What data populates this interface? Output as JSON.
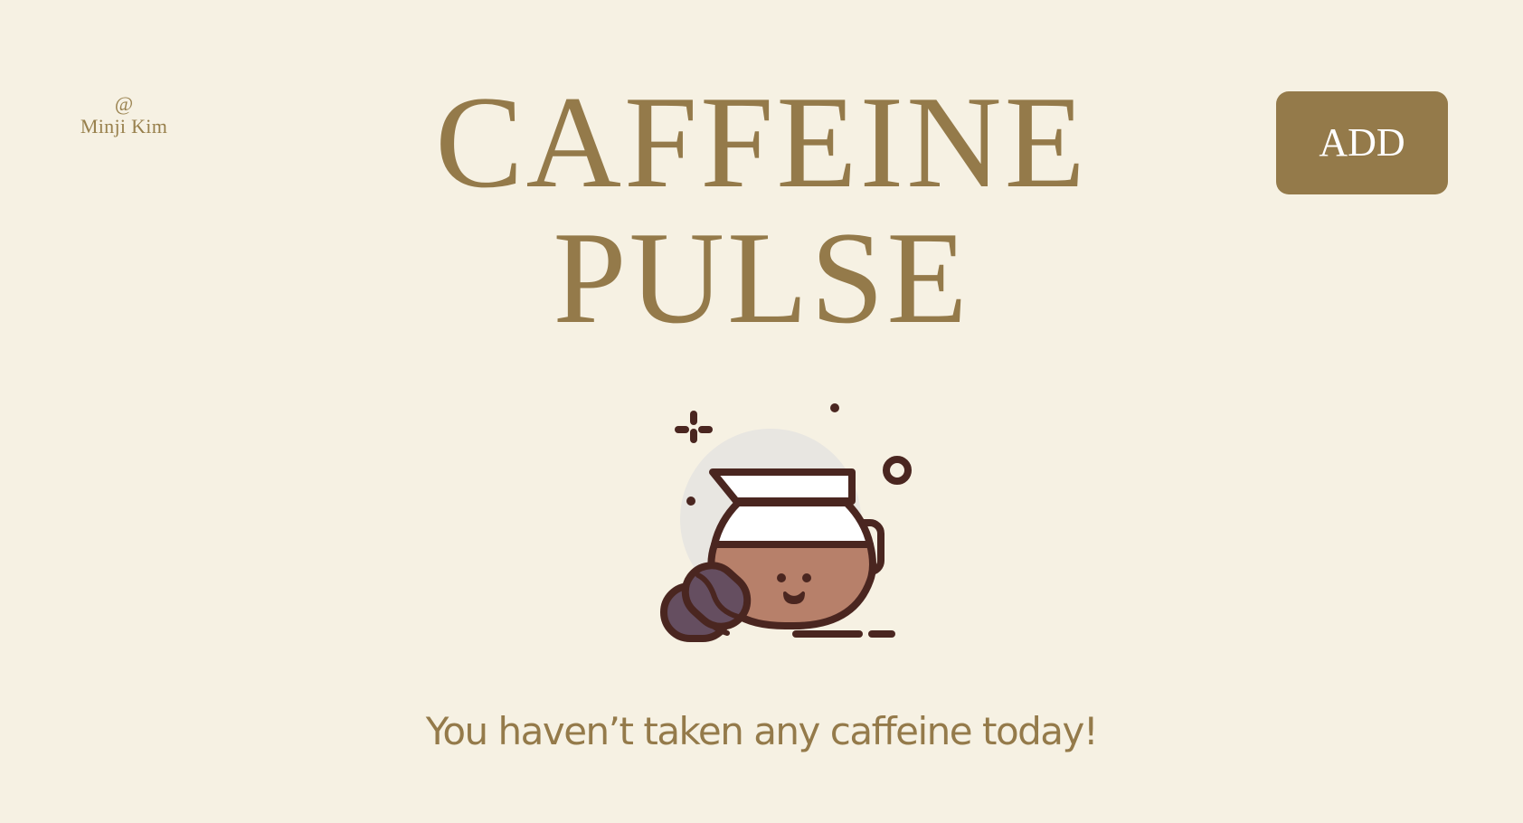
{
  "user": {
    "at_symbol": "@",
    "name": "Minji Kim"
  },
  "header": {
    "title_line1": "CAFFEINE",
    "title_line2": "PULSE",
    "add_label": "ADD"
  },
  "illustration": {
    "icon": "coffee-pot-with-beans-icon"
  },
  "status": {
    "message": "You haven’t taken any caffeine today!"
  },
  "colors": {
    "background": "#f6f1e3",
    "accent": "#947a4a",
    "outline": "#4a2620",
    "coffee": "#b7806a",
    "bean": "#654e60"
  }
}
